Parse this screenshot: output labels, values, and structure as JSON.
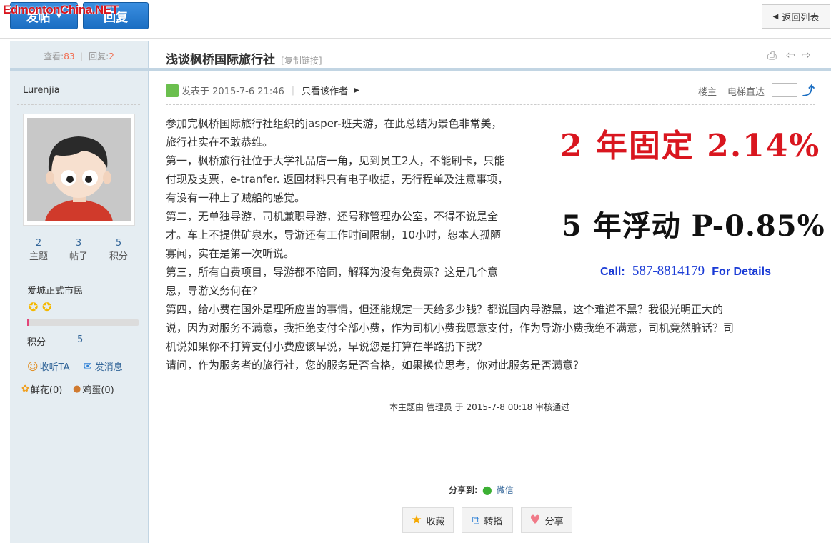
{
  "toolbar": {
    "post_label": "发帖",
    "reply_label": "回复",
    "back_label": "返回列表",
    "watermark": "EdmontonChina.NET"
  },
  "thread_stats": {
    "views_label": "查看:",
    "views": "83",
    "sep": "|",
    "replies_label": "回复:",
    "replies": "2"
  },
  "thread": {
    "title": "浅谈枫桥国际旅行社",
    "copy_link": "[复制链接]"
  },
  "author": {
    "name": "Lurenjia",
    "stats": [
      {
        "value": "2",
        "label": "主题"
      },
      {
        "value": "3",
        "label": "帖子"
      },
      {
        "value": "5",
        "label": "积分"
      }
    ],
    "rank": "爱城正式市民",
    "points_label": "积分",
    "points": "5",
    "follow_label": "收听TA",
    "message_label": "发消息",
    "flowers_label": "鲜花(0)",
    "eggs_label": "鸡蛋(0)"
  },
  "post_meta": {
    "posted": "发表于 2015-7-6 21:46",
    "sep": "|",
    "only_author": "只看该作者",
    "floor": "楼主",
    "jump_label": "电梯直达"
  },
  "post_lines": [
    "参加完枫桥国际旅行社组织的jasper-班夫游，在此总结为景色非常美，",
    "旅行社实在不敢恭维。",
    "第一，枫桥旅行社位于大学礼品店一角，见到员工2人，不能刷卡，只能",
    "付现及支票，e-tranfer. 返回材料只有电子收据，无行程单及注意事项，",
    "有没有一种上了贼船的感觉。",
    "第二，无单独导游，司机兼职导游，还号称管理办公室，不得不说是全",
    "才。车上不提供矿泉水，导游还有工作时间限制，10小时，恕本人孤陋",
    "寡闻，实在是第一次听说。",
    "第三，所有自费项目，导游都不陪同，解释为没有免费票？这是几个意",
    "思，导游义务何在？",
    "第四，给小费在国外是理所应当的事情，但还能规定一天给多少钱？都说国内导游黑，这个难道不黑？我很光明正大的",
    "说，因为对服务不满意，我拒绝支付全部小费，作为司机小费我愿意支付，作为导游小费我绝不满意，司机竟然脏话？司",
    "机说如果你不打算支付小费应该早说，早说您是打算在半路扔下我？",
    "请问，作为服务者的旅行社，您的服务是否合格，如果换位思考，你对此服务是否满意？"
  ],
  "ad": {
    "line1": "2 年固定 2.14%",
    "line2": "5 年浮动 P-0.85%",
    "call_label": "Call:",
    "phone": "587-8814179",
    "details": "For Details"
  },
  "moderation_note": "本主题由 管理员 于 2015-7-8 00:18 审核通过",
  "share": {
    "label": "分享到:",
    "wechat": "微信"
  },
  "actions": {
    "favorite": "收藏",
    "forward": "转播",
    "share": "分享"
  },
  "colors": {
    "accent": "#1b6ec2",
    "ad_red": "#d9161f",
    "ad_blue": "#1a3bd6",
    "sidebar_bg": "#e5edf2"
  }
}
